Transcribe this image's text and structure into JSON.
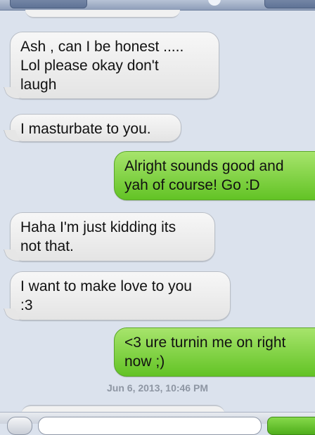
{
  "messages": [
    {
      "direction": "incoming",
      "text": "Ash , can I be honest .....\nLol please okay don't\nlaugh"
    },
    {
      "direction": "incoming",
      "text": "I masturbate to you."
    },
    {
      "direction": "outgoing",
      "text": "Alright sounds good and\nyah of course! Go :D"
    },
    {
      "direction": "incoming",
      "text": "Haha I'm just kidding its\nnot that."
    },
    {
      "direction": "incoming",
      "text": "I want to make love to you\n:3"
    },
    {
      "direction": "outgoing",
      "text": "<3 ure turnin me on right\nnow ;)"
    }
  ],
  "timestamp": "Jun 6, 2013, 10:46 PM",
  "colors": {
    "incoming": "#ececec",
    "outgoing": "#7bd13c",
    "background": "#dbe2ed"
  },
  "icons": {
    "camera": "camera-icon"
  }
}
